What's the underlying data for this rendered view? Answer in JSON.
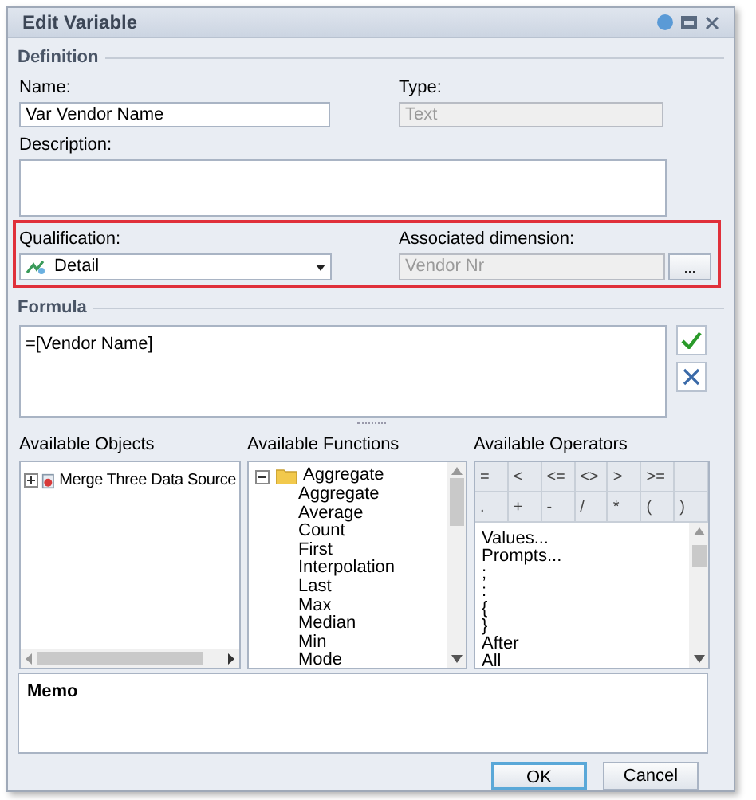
{
  "window": {
    "title": "Edit Variable"
  },
  "definition": {
    "heading": "Definition",
    "name": {
      "label": "Name:",
      "value": "Var Vendor Name"
    },
    "type": {
      "label": "Type:",
      "value": "Text",
      "disabled": true
    },
    "description": {
      "label": "Description:"
    },
    "qualification": {
      "label": "Qualification:",
      "value": "Detail"
    },
    "associated_dimension": {
      "label": "Associated dimension:",
      "value": "Vendor Nr",
      "disabled": true,
      "button": "..."
    }
  },
  "formula": {
    "heading": "Formula",
    "value": "=[Vendor Name]"
  },
  "available_objects": {
    "label": "Available Objects",
    "items": [
      {
        "label": "Merge Three Data Source",
        "expanded": false
      }
    ]
  },
  "available_functions": {
    "label": "Available Functions",
    "items": [
      {
        "label": "Aggregate",
        "expanded": true,
        "children": [
          {
            "label": "Aggregate"
          },
          {
            "label": "Average"
          },
          {
            "label": "Count"
          },
          {
            "label": "First"
          },
          {
            "label": "Interpolation"
          },
          {
            "label": "Last"
          },
          {
            "label": "Max"
          },
          {
            "label": "Median"
          },
          {
            "label": "Min"
          },
          {
            "label": "Mode"
          }
        ]
      }
    ]
  },
  "available_operators": {
    "label": "Available Operators",
    "buttons": [
      [
        "=",
        "<",
        "<=",
        "<>",
        ">",
        ">="
      ],
      [
        ".",
        "+",
        "-",
        "/",
        "*",
        "(",
        ")"
      ]
    ],
    "items": [
      "Values...",
      "Prompts...",
      ";",
      ":",
      "{",
      "}",
      "After",
      "All"
    ]
  },
  "memo": {
    "label": "Memo"
  },
  "buttons": [
    {
      "label": "OK",
      "default": true
    },
    {
      "label": "Cancel",
      "default": false
    }
  ]
}
